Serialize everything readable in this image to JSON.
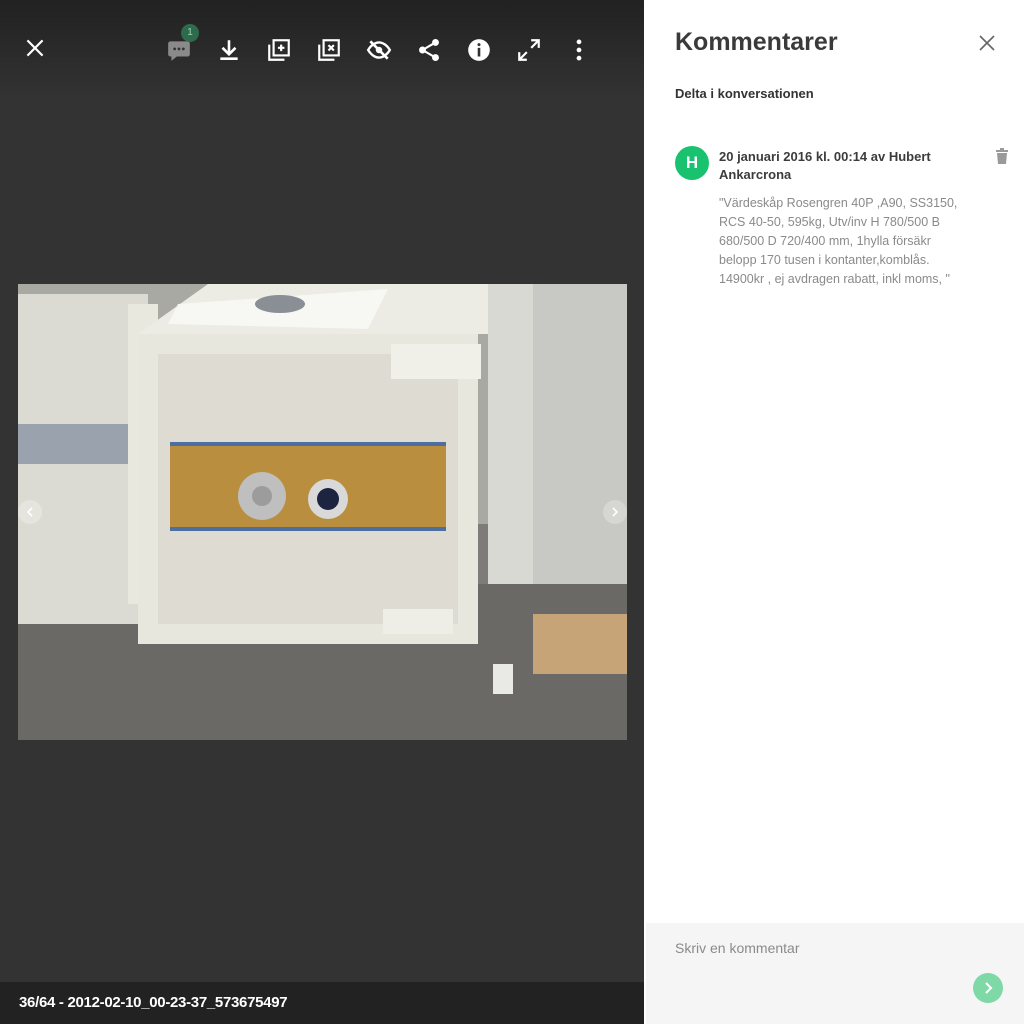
{
  "viewer": {
    "toolbar": {
      "close_icon": "close-icon",
      "comments_count": "1",
      "buttons": [
        "comment-icon",
        "download-icon",
        "add-to-album-icon",
        "remove-from-album-icon",
        "hide-icon",
        "share-icon",
        "info-icon",
        "fullscreen-icon",
        "more-vert-icon"
      ]
    },
    "caption": "36/64 - 2012-02-10_00-23-37_573675497"
  },
  "panel": {
    "title": "Kommentarer",
    "join_link": "Delta i konversationen",
    "comments": [
      {
        "avatar_initial": "H",
        "avatar_color": "#19c26e",
        "meta": "20 januari 2016 kl. 00:14 av Hubert Ankarcrona",
        "body": "\"Värdeskåp Rosengren 40P ,A90, SS3150, RCS 40-50, 595kg, Utv/inv H 780/500 B 680/500 D 720/400 mm, 1hylla försäkr belopp 170 tusen i kontanter,komblås. 14900kr , ej avdragen rabatt, inkl moms, \""
      }
    ],
    "composer": {
      "placeholder": "Skriv en kommentar"
    }
  },
  "colors": {
    "viewer_bg": "#333333",
    "accent": "#19c26e",
    "send_button": "#7fd9a6"
  }
}
